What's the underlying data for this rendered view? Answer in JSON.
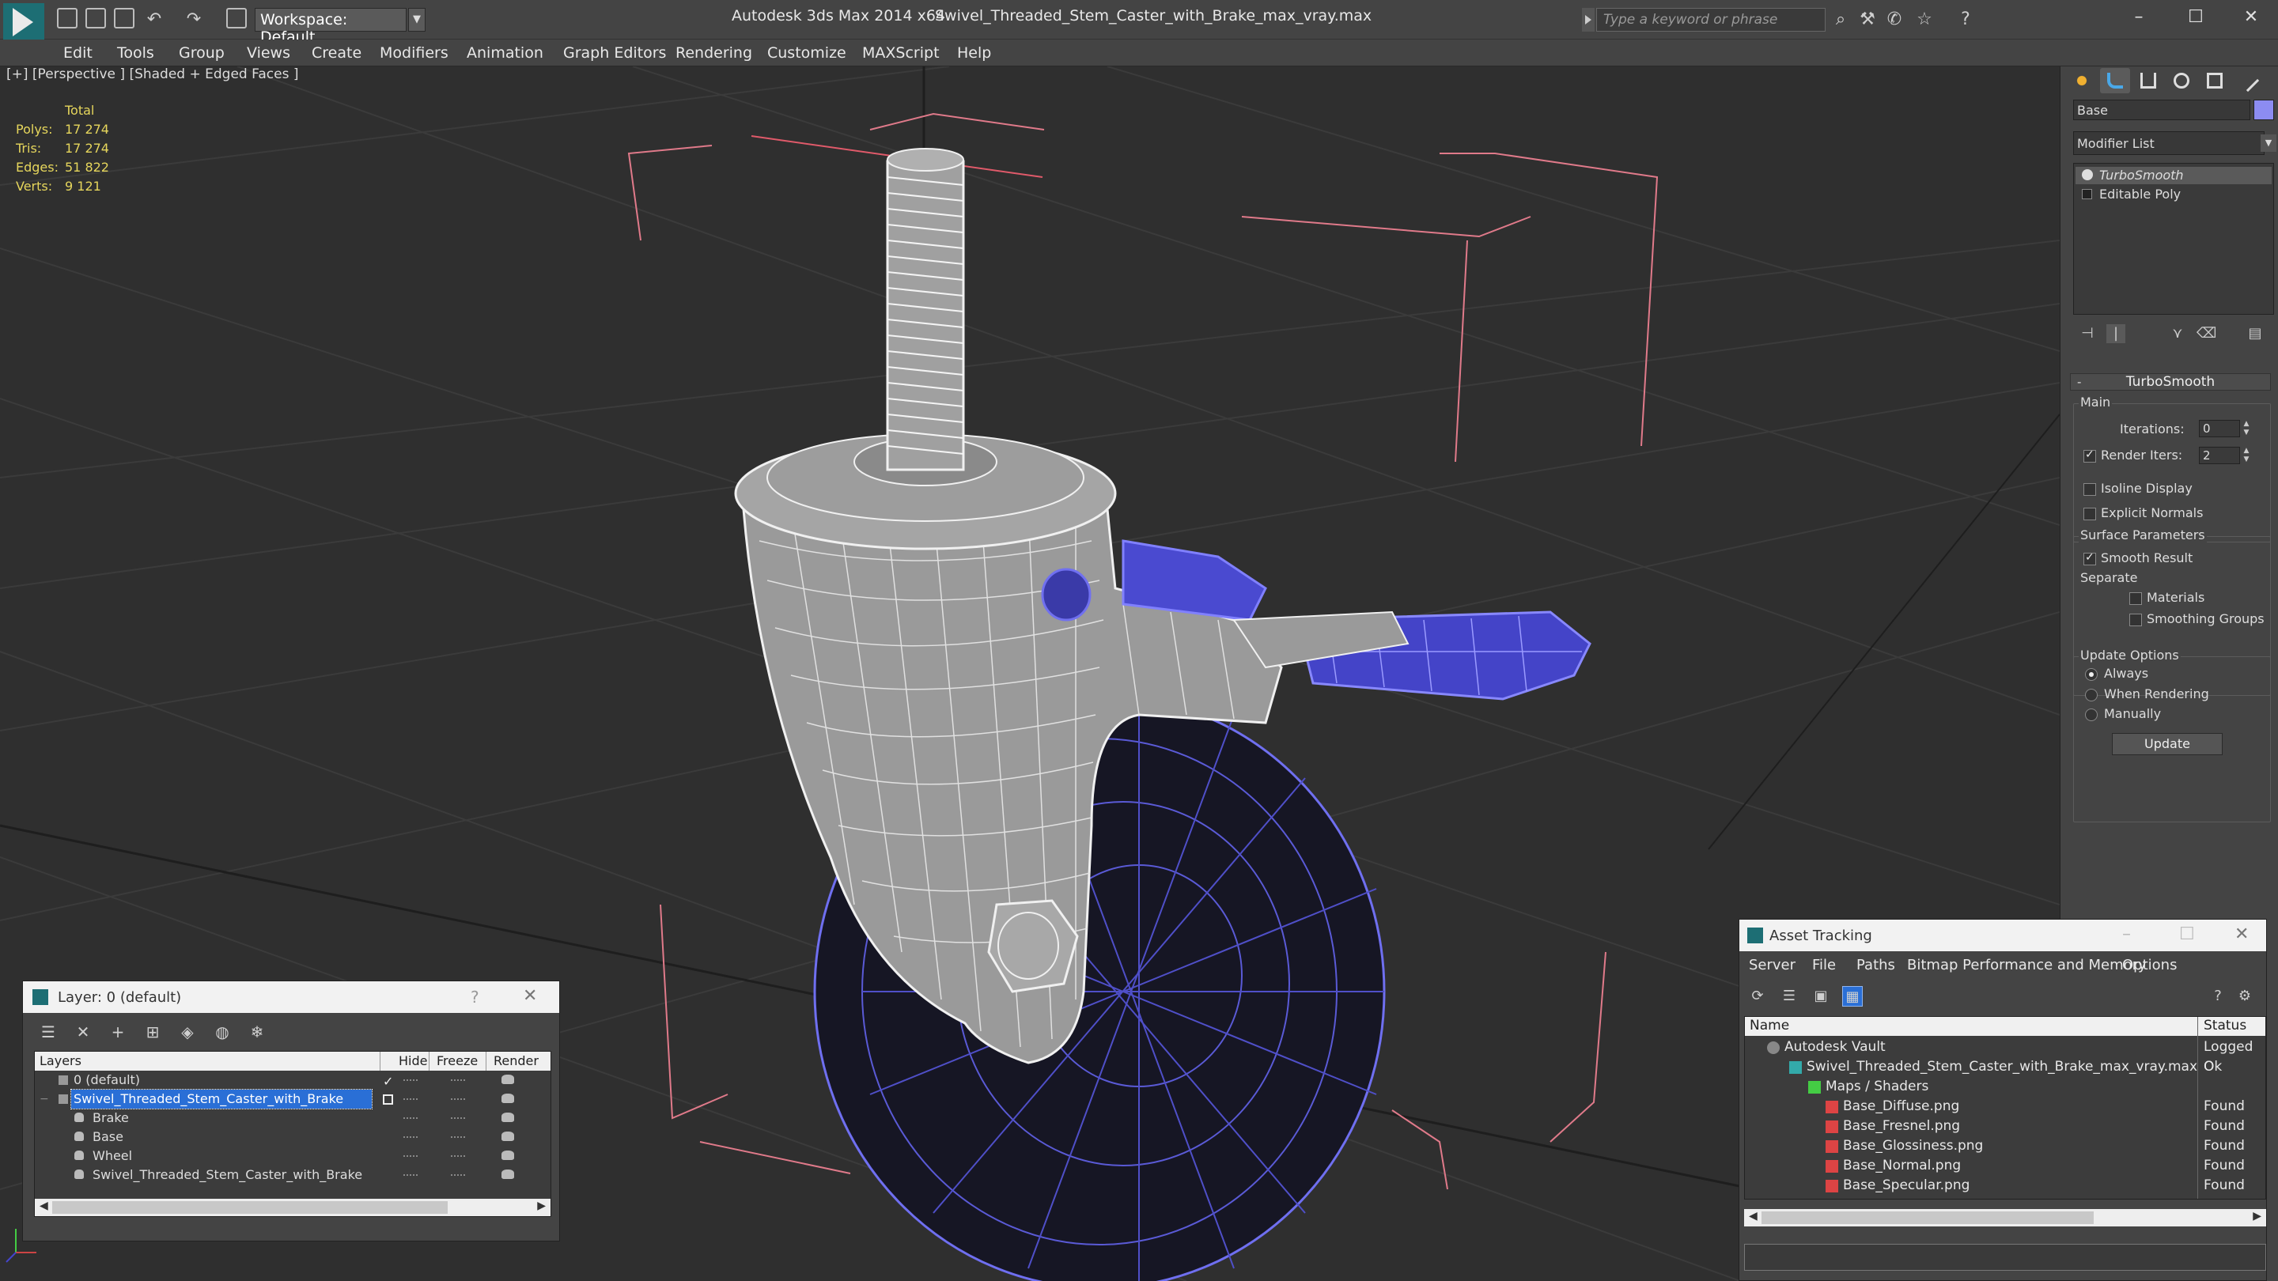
{
  "window": {
    "app_title": "Autodesk 3ds Max  2014 x64",
    "file_title": "Swivel_Threaded_Stem_Caster_with_Brake_max_vray.max",
    "workspace": "Workspace: Default",
    "search_placeholder": "Type a keyword or phrase",
    "minimize": "–",
    "maximize": "☐",
    "close": "✕"
  },
  "menu": [
    "Edit",
    "Tools",
    "Group",
    "Views",
    "Create",
    "Modifiers",
    "Animation",
    "Graph Editors",
    "Rendering",
    "Customize",
    "MAXScript",
    "Help"
  ],
  "viewport": {
    "label": "[+] [Perspective ] [Shaded + Edged Faces ]",
    "stats": {
      "header": "Total",
      "rows": [
        {
          "k": "Polys:",
          "v": "17 274"
        },
        {
          "k": "Tris:",
          "v": "17 274"
        },
        {
          "k": "Edges:",
          "v": "51 822"
        },
        {
          "k": "Verts:",
          "v": "9 121"
        }
      ]
    }
  },
  "command_panel": {
    "object_name": "Base",
    "object_color": "#8c8cf2",
    "modifier_list": "Modifier List",
    "stack": [
      "TurboSmooth",
      "Editable Poly"
    ],
    "rollout_title": "TurboSmooth",
    "main_group": "Main",
    "iterations_label": "Iterations:",
    "iterations_value": "0",
    "render_iters_label": "Render Iters:",
    "render_iters_value": "2",
    "isoline_display": "Isoline Display",
    "explicit_normals": "Explicit Normals",
    "surface_group": "Surface Parameters",
    "smooth_result": "Smooth Result",
    "separate_label": "Separate",
    "materials": "Materials",
    "smoothing_groups": "Smoothing Groups",
    "update_group": "Update Options",
    "always": "Always",
    "when_rendering": "When Rendering",
    "manually": "Manually",
    "update_button": "Update"
  },
  "layer_dialog": {
    "title": "Layer: 0 (default)",
    "help": "?",
    "close": "✕",
    "columns": {
      "layers": "Layers",
      "hide": "Hide",
      "freeze": "Freeze",
      "render": "Render"
    },
    "rows": [
      {
        "name": "0 (default)"
      },
      {
        "name": "Swivel_Threaded_Stem_Caster_with_Brake"
      },
      {
        "name": "Brake"
      },
      {
        "name": "Base"
      },
      {
        "name": "Wheel"
      },
      {
        "name": "Swivel_Threaded_Stem_Caster_with_Brake"
      }
    ]
  },
  "asset_dialog": {
    "title": "Asset Tracking",
    "menu": [
      "Server",
      "File",
      "Paths",
      "Bitmap Performance and Memory",
      "Options"
    ],
    "columns": {
      "name": "Name",
      "status": "Status"
    },
    "rows": [
      {
        "name": "Autodesk Vault",
        "status": "Logged O"
      },
      {
        "name": "Swivel_Threaded_Stem_Caster_with_Brake_max_vray.max",
        "status": "Ok"
      },
      {
        "name": "Maps / Shaders",
        "status": ""
      },
      {
        "name": "Base_Diffuse.png",
        "status": "Found"
      },
      {
        "name": "Base_Fresnel.png",
        "status": "Found"
      },
      {
        "name": "Base_Glossiness.png",
        "status": "Found"
      },
      {
        "name": "Base_Normal.png",
        "status": "Found"
      },
      {
        "name": "Base_Specular.png",
        "status": "Found"
      }
    ]
  }
}
